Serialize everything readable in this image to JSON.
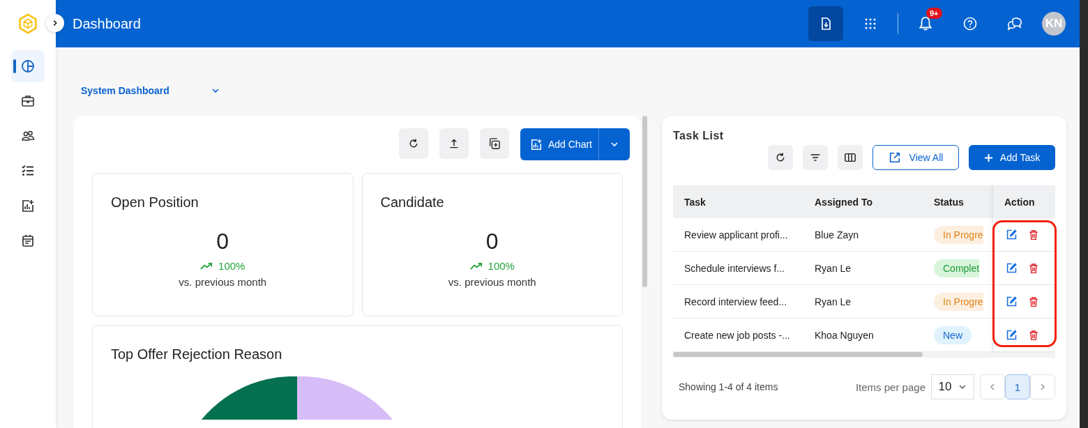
{
  "sidebar": {
    "items": [
      {
        "selected": true
      },
      {
        "selected": false
      },
      {
        "selected": false
      },
      {
        "selected": false
      },
      {
        "selected": false
      },
      {
        "selected": false
      }
    ]
  },
  "header": {
    "title": "Dashboard",
    "notification_badge": "9+",
    "avatar": "KN"
  },
  "dashboard_select": {
    "value": "System Dashboard"
  },
  "left_panel": {
    "add_chart_button": "Add Chart",
    "stats": [
      {
        "title": "Open Position",
        "value": "0",
        "change": "100%",
        "caption": "vs. previous month"
      },
      {
        "title": "Candidate",
        "value": "0",
        "change": "100%",
        "caption": "vs. previous month"
      }
    ],
    "chart_card": {
      "title": "Top Offer Rejection Reason"
    }
  },
  "task_list": {
    "title": "Task List",
    "view_all_button": "View All",
    "add_task_button": "Add Task",
    "columns": [
      "Task",
      "Assigned To",
      "Status",
      "Action"
    ],
    "action_highlighted": true,
    "rows": [
      {
        "task": "Review applicant profi...",
        "assigned_to": "Blue Zayn",
        "status": "In Progre",
        "kind": "progress"
      },
      {
        "task": "Schedule interviews f...",
        "assigned_to": "Ryan Le",
        "status": "Complet",
        "kind": "completed"
      },
      {
        "task": "Record interview feed...",
        "assigned_to": "Ryan Le",
        "status": "In Progre",
        "kind": "progress"
      },
      {
        "task": "Create new job posts -...",
        "assigned_to": "Khoa Nguyen",
        "status": "New",
        "kind": "new"
      }
    ],
    "summary": "Showing 1-4 of 4 items",
    "items_per_page_label": "Items per page",
    "items_per_page": "10",
    "pages": [
      {
        "label": "1",
        "selected": true
      }
    ]
  }
}
